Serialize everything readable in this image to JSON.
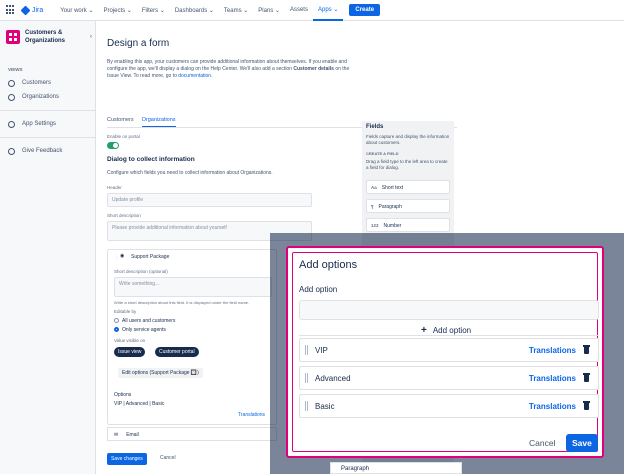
{
  "topbar": {
    "brand": "Jira",
    "nav": [
      "Your work ⌄",
      "Projects ⌄",
      "Filters ⌄",
      "Dashboards ⌄",
      "Teams ⌄",
      "Plans ⌄",
      "Assets",
      "Apps ⌄"
    ],
    "active_index": 7,
    "create_label": "Create"
  },
  "sidebar": {
    "project_name": "Customers & Organizations",
    "views_label": "VIEWS",
    "items": [
      {
        "label": "Customers",
        "icon": "person-icon"
      },
      {
        "label": "Organizations",
        "icon": "group-icon"
      }
    ],
    "settings_label": "App Settings",
    "feedback_label": "Give Feedback"
  },
  "main": {
    "title": "Design a form",
    "intro_1": "By enabling this app, your customers can provide additional information about themselves. If you enable and configure the app, we'll display a dialog on the Help Center. We'll also add a section ",
    "intro_bold": "Customer details",
    "intro_2": " on the Issue View. To read more, go to ",
    "intro_link": "documentation",
    "intro_end": ".",
    "tabs": [
      "Customers",
      "Organizations"
    ],
    "active_tab": 1,
    "enable_label": "Enable on portal",
    "dialog_title": "Dialog to collect information",
    "dialog_desc": "Configure which fields you need to collect information about Organizations.",
    "header_label": "Header",
    "header_value": "Update profile",
    "short_desc_label": "Short description",
    "short_desc_value": "Please provide additional information about yourself",
    "field_card": {
      "name": "Support Package",
      "short_desc_opt_label": "Short description (optional)",
      "write_placeholder": "Write something...",
      "hint": "Write a short description about this field. It is displayed under the field name.",
      "editable_by_label": "Editable by",
      "opt_all": "All users and customers",
      "opt_agents": "Only service agents",
      "visible_label": "Value visible on",
      "pill_issue": "Issue view",
      "pill_portal": "Customer portal",
      "edit_options": "Edit options (Support Package 🔲)",
      "options_label": "Options",
      "options_value": "VIP | Advanced | Basic",
      "translations": "Translations"
    },
    "email_label": "Email",
    "save_changes": "Save changes",
    "cancel": "Cancel"
  },
  "fields_panel": {
    "title": "Fields",
    "desc": "Fields capture and display the information about customers.",
    "create_label": "CREATE A FIELD",
    "drag_desc": "Drag a field type to the left area to create a field for dialog.",
    "types": [
      {
        "abbr": "Aa",
        "label": "Short text"
      },
      {
        "abbr": "¶",
        "label": "Paragraph"
      },
      {
        "abbr": "123",
        "label": "Number"
      }
    ]
  },
  "modal": {
    "title": "Add options",
    "add_option_label": "Add option",
    "add_option_button": "Add option",
    "options": [
      {
        "name": "VIP",
        "action": "Translations"
      },
      {
        "name": "Advanced",
        "action": "Translations"
      },
      {
        "name": "Basic",
        "action": "Translations"
      }
    ],
    "cancel": "Cancel",
    "save": "Save"
  },
  "peek_label": "Paragraph",
  "colors": {
    "accent": "#0c66e4",
    "highlight": "#e2007a",
    "toggle_on": "#22a06b"
  }
}
